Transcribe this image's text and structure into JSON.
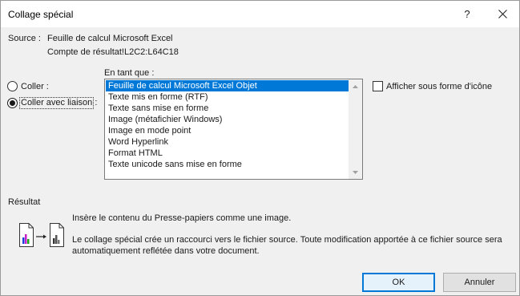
{
  "window": {
    "title": "Collage spécial",
    "help_label": "?",
    "close_icon": "close-icon"
  },
  "source": {
    "label": "Source :",
    "line1": "Feuille de calcul Microsoft Excel",
    "line2": "Compte de résultat!L2C2:L64C18"
  },
  "paste_options": {
    "coller_label": "Coller :",
    "coller_avec_liaison_label": "Coller avec liaison :",
    "selected": "Coller avec liaison :"
  },
  "as_type": {
    "label": "En tant que :",
    "items": [
      "Feuille de calcul Microsoft Excel Objet",
      "Texte mis en forme (RTF)",
      "Texte sans mise en forme",
      "Image (métafichier Windows)",
      "Image en mode point",
      "Word Hyperlink",
      "Format HTML",
      "Texte unicode sans mise en forme"
    ],
    "selected_index": 0
  },
  "display_as_icon": {
    "label": "Afficher sous forme d'icône",
    "checked": false
  },
  "result": {
    "label": "Résultat",
    "line1": "Insère le contenu du Presse-papiers comme une image.",
    "line2": "Le collage spécial crée un raccourci vers le fichier source. Toute modification apportée à ce fichier source sera",
    "line3": "automatiquement reflétée dans votre document.",
    "icon": "paste-link-icon"
  },
  "buttons": {
    "ok": "OK",
    "cancel": "Annuler"
  },
  "colors": {
    "selection": "#0078d7",
    "dialog_bg": "#f0f0f0"
  }
}
